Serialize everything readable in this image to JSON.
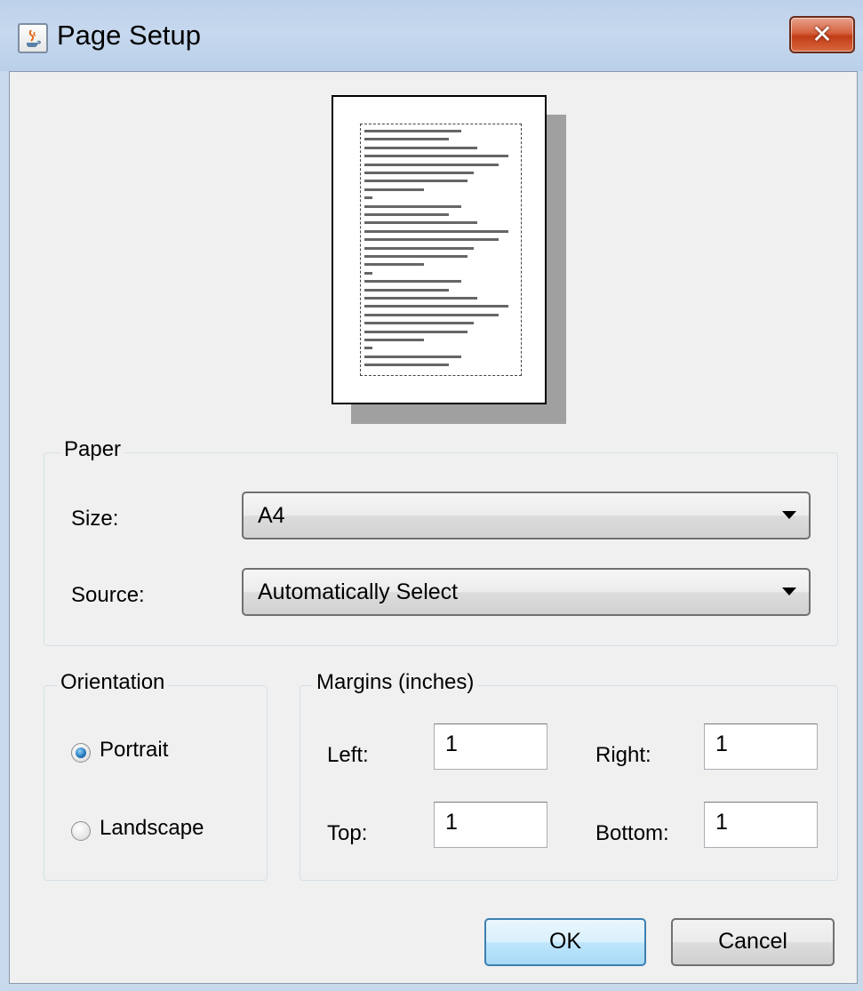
{
  "window": {
    "title": "Page Setup",
    "close_label": "✕",
    "icon": "java-cup-icon"
  },
  "paper": {
    "legend": "Paper",
    "size_label": "Size:",
    "size_value": "A4",
    "source_label": "Source:",
    "source_value": "Automatically Select"
  },
  "orientation": {
    "legend": "Orientation",
    "options": [
      {
        "label": "Portrait",
        "selected": true
      },
      {
        "label": "Landscape",
        "selected": false
      }
    ]
  },
  "margins": {
    "legend": "Margins (inches)",
    "left_label": "Left:",
    "left_value": "1",
    "right_label": "Right:",
    "right_value": "1",
    "top_label": "Top:",
    "top_value": "1",
    "bottom_label": "Bottom:",
    "bottom_value": "1"
  },
  "buttons": {
    "ok_label": "OK",
    "cancel_label": "Cancel"
  },
  "colors": {
    "title_bar": "#c6d8ee",
    "dialog_bg": "#f0f0f0",
    "ok_border": "#3c7fb1",
    "close_red": "#c23c16"
  }
}
